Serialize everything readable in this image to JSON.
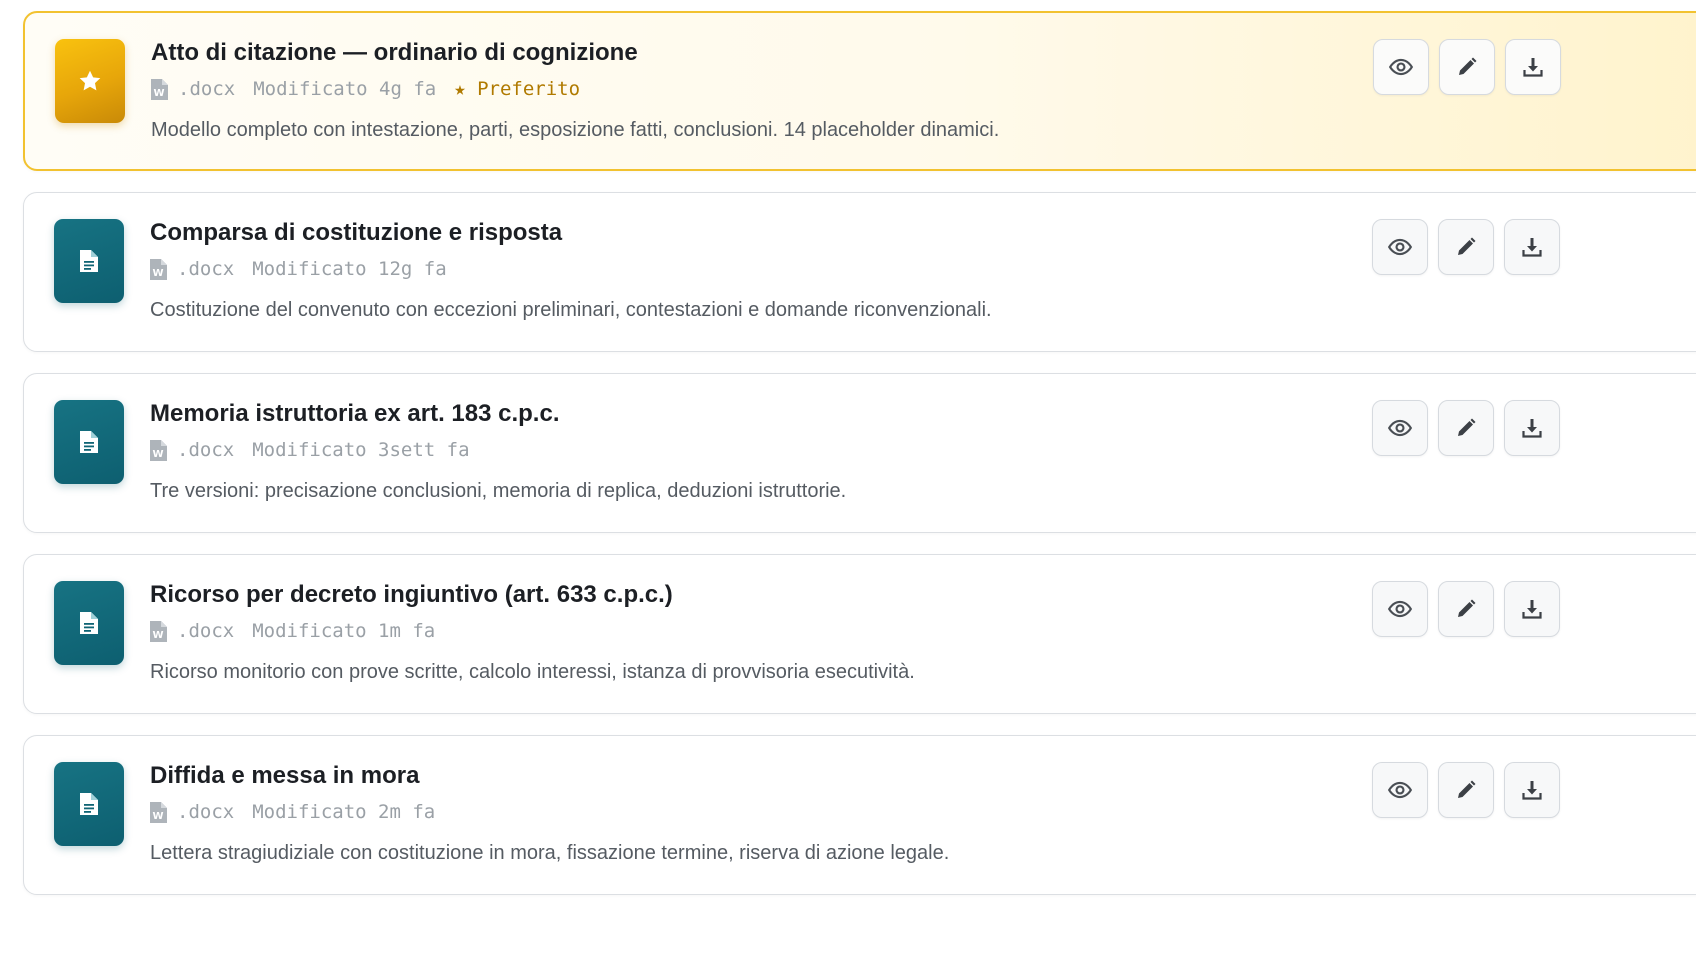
{
  "templates": [
    {
      "favorite": true,
      "icon": "star-icon",
      "title": "Atto di citazione — ordinario di cognizione",
      "ext": ".docx",
      "modified": "Modificato 4g fa",
      "badge": "★ Preferito",
      "description": "Modello completo con intestazione, parti, esposizione fatti, conclusioni. 14 placeholder dinamici."
    },
    {
      "favorite": false,
      "icon": "document-icon",
      "title": "Comparsa di costituzione e risposta",
      "ext": ".docx",
      "modified": "Modificato 12g fa",
      "description": "Costituzione del convenuto con eccezioni preliminari, contestazioni e domande riconvenzionali."
    },
    {
      "favorite": false,
      "icon": "document-icon",
      "title": "Memoria istruttoria ex art. 183 c.p.c.",
      "ext": ".docx",
      "modified": "Modificato 3sett fa",
      "description": "Tre versioni: precisazione conclusioni, memoria di replica, deduzioni istruttorie."
    },
    {
      "favorite": false,
      "icon": "document-icon",
      "title": "Ricorso per decreto ingiuntivo (art. 633 c.p.c.)",
      "ext": ".docx",
      "modified": "Modificato 1m fa",
      "description": "Ricorso monitorio con prove scritte, calcolo interessi, istanza di provvisoria esecutività."
    },
    {
      "favorite": false,
      "icon": "document-icon",
      "title": "Diffida e messa in mora",
      "ext": ".docx",
      "modified": "Modificato 2m fa",
      "description": "Lettera stragiudiziale con costituzione in mora, fissazione termine, riserva di azione legale."
    }
  ],
  "actions": [
    "eye-icon",
    "pencil-icon",
    "download-icon"
  ],
  "colors": {
    "favorite_accent": "#f2c230",
    "document_tile": "#0f6474",
    "favorite_label": "#b07a00"
  }
}
